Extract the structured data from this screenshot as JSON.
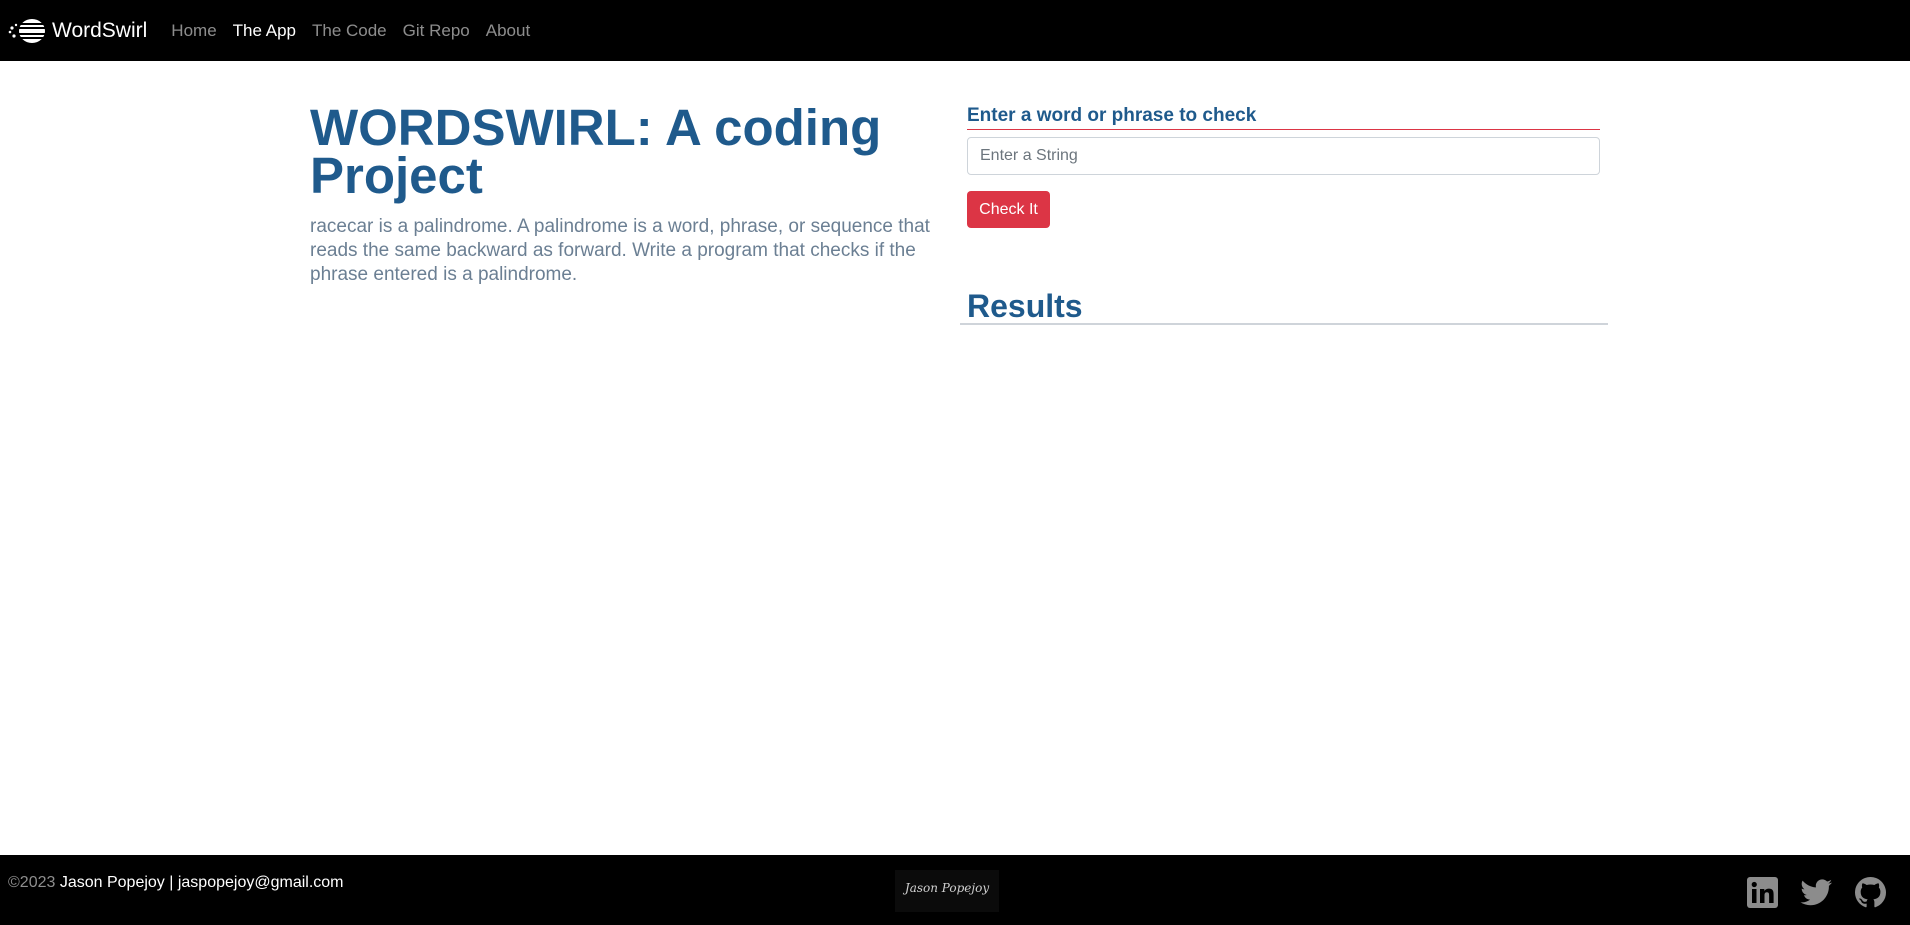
{
  "navbar": {
    "brand": "WordSwirl",
    "links": [
      {
        "label": "Home",
        "active": false
      },
      {
        "label": "The App",
        "active": true
      },
      {
        "label": "The Code",
        "active": false
      },
      {
        "label": "Git Repo",
        "active": false
      },
      {
        "label": "About",
        "active": false
      }
    ]
  },
  "intro": {
    "title": "WORDSWIRL: A coding Project",
    "description": "racecar is a palindrome. A palindrome is a word, phrase, or sequence that reads the same backward as forward. Write a program that checks if the phrase entered is a palindrome."
  },
  "form": {
    "label": "Enter a word or phrase to check",
    "input_value": "",
    "input_placeholder": "Enter a String",
    "button_label": "Check It"
  },
  "results": {
    "title": "Results"
  },
  "footer": {
    "copyright_year": "©2023",
    "copyright_text": " Jason Popejoy | jaspopejoy@gmail.com",
    "signature": "Jason Popejoy",
    "social_icons": [
      "linkedin-icon",
      "twitter-icon",
      "github-icon"
    ]
  },
  "colors": {
    "navbar_bg": "#000000",
    "heading": "#1f5a8c",
    "accent": "#dc3545",
    "body_text": "#6b7f93",
    "social_icon": "#8c8c8c"
  }
}
